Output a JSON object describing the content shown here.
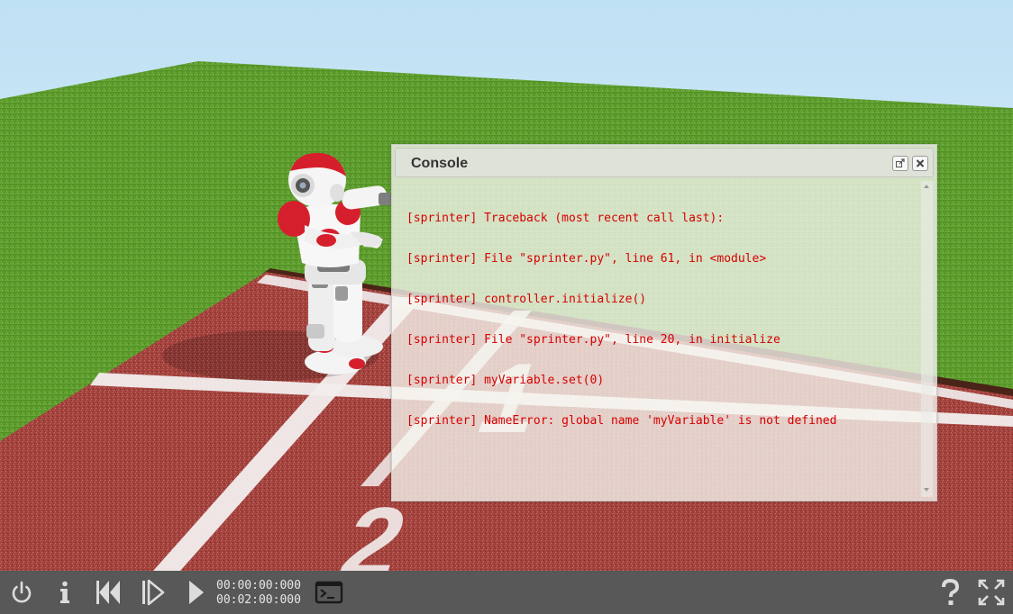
{
  "console": {
    "title": "Console",
    "lines": [
      "[sprinter] Traceback (most recent call last):",
      "[sprinter] File \"sprinter.py\", line 61, in <module>",
      "[sprinter] controller.initialize()",
      "[sprinter] File \"sprinter.py\", line 20, in initialize",
      "[sprinter] myVariable.set(0)",
      "[sprinter] NameError: global name 'myVariable' is not defined"
    ],
    "text_color": "#d60000",
    "buttons": {
      "popout_icon": "external-link-icon",
      "close_icon": "close-icon"
    }
  },
  "toolbar": {
    "elapsed_time": "00:00:00:000",
    "run_time": "00:02:00:000",
    "icons": [
      "power-icon",
      "info-icon",
      "reset-icon",
      "step-icon",
      "play-icon",
      "terminal-icon",
      "help-icon",
      "fullscreen-icon"
    ],
    "background": "#585858"
  },
  "scene": {
    "sky_color": "#c8e6f5",
    "grass_color": "#5a9a2a",
    "track_color": "#a4443e",
    "lane_numbers": [
      "1",
      "2"
    ]
  }
}
